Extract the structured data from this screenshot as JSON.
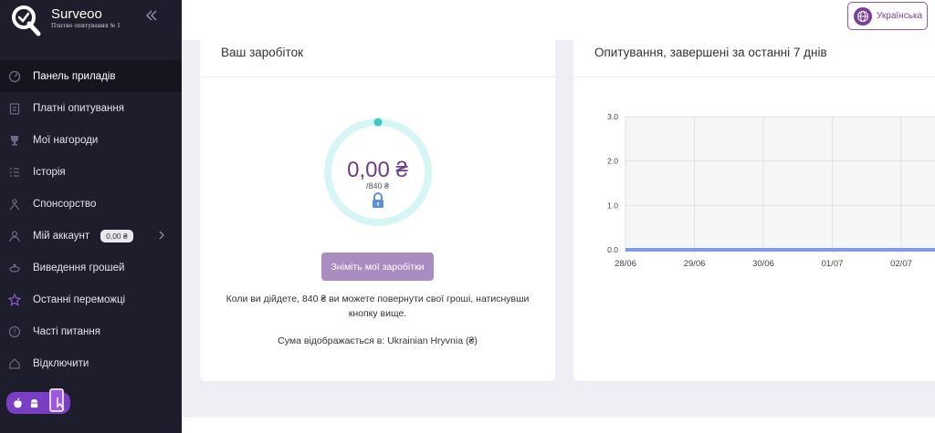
{
  "brand": {
    "name": "Surveoo",
    "tagline": "Платне опитування № 1",
    "logo_icon": "surveoo-logo-icon",
    "collapse_icon": "double-chevron-left-icon"
  },
  "sidebar": {
    "items": [
      {
        "label": "Панель приладів",
        "icon": "dashboard-icon",
        "active": true
      },
      {
        "label": "Платні опитування",
        "icon": "clipboard-icon"
      },
      {
        "label": "Мої нагороди",
        "icon": "trophy-icon"
      },
      {
        "label": "Історія",
        "icon": "list-icon"
      },
      {
        "label": "Спонсорство",
        "icon": "people-icon"
      },
      {
        "label": "Мій аккаунт",
        "icon": "user-icon",
        "badge": "0,00 ₴",
        "chevron": "chevron-right-icon"
      },
      {
        "label": "Виведення грошей",
        "icon": "money-icon"
      },
      {
        "label": "Останні переможці",
        "icon": "star-icon"
      },
      {
        "label": "Часті питання",
        "icon": "question-icon"
      },
      {
        "label": "Відключити",
        "icon": "home-icon"
      }
    ],
    "apps": {
      "icons": [
        "apple-icon",
        "android-icon",
        "phone-touch-icon"
      ],
      "color": "#7a3ec4"
    }
  },
  "header": {
    "language_label": "Українська",
    "language_icon": "globe-icon"
  },
  "earnings": {
    "title": "Ваш заробіток",
    "amount": "0,00 ₴",
    "target": "/840 ₴",
    "progress": 0,
    "lock_icon": "lock-icon",
    "withdraw_label": "Зніміть мої заробітки",
    "info_text": "Коли ви дійдете, 840 ₴ ви можете повернути свої гроші, натиснувши кнопку вище.",
    "currency_text": "Сума відображається в: Ukrainian Hryvnia (₴)"
  },
  "chart_card": {
    "title": "Опитування, завершені за останні 7 днів"
  },
  "chart_data": {
    "type": "line",
    "x": [
      "28/06",
      "29/06",
      "30/06",
      "01/07",
      "02/07"
    ],
    "series": [
      {
        "values": [
          0,
          0,
          0,
          0,
          0
        ],
        "color": "#7f9be8"
      }
    ],
    "yticks": [
      "0.0",
      "1.0",
      "2.0",
      "3.0"
    ],
    "ylim": [
      0,
      3
    ],
    "grid": true,
    "title": "",
    "xlabel": "",
    "ylabel": ""
  },
  "colors": {
    "accent": "#7b3fa0",
    "ring": "#d6f6f5",
    "ring_dot": "#3cc9c3",
    "sidebar_bg": "#1e1d2b"
  }
}
